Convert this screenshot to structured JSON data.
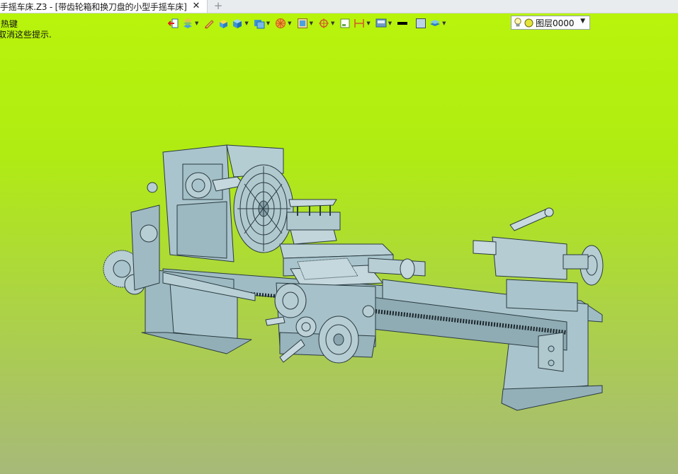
{
  "tab": {
    "title": "手摇车床.Z3 - [带齿轮箱和换刀盘的小型手摇车床]",
    "close": "✕",
    "add": "+"
  },
  "hints": {
    "hotkey": "热键",
    "cancel": "取消这些提示."
  },
  "toolbar": {
    "icons": [
      "exit-sketch-icon",
      "layers-stack-icon",
      "pencil-icon",
      "solid-box-icon",
      "view-cube-icon",
      "render-cube-icon",
      "orange-wheel-icon",
      "frame-select-icon",
      "snap-target-icon",
      "sketch-rect-icon",
      "dimension-icon",
      "display-mode-icon",
      "line-color-icon",
      "face-color-icon",
      "layer-stack-icon"
    ]
  },
  "layer_selector": {
    "value": "图层0000",
    "lightbulb": "lightbulb-icon",
    "color_dot": "#e3e33a"
  },
  "colors": {
    "background_top": "#b8f40b",
    "background_bottom": "#a7b979",
    "model_fill": "#a9c4cc",
    "model_edge": "#2a3a40"
  }
}
